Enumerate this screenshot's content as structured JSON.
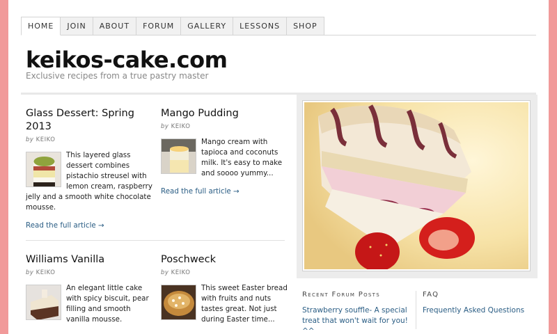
{
  "nav": {
    "items": [
      {
        "label": "HOME"
      },
      {
        "label": "JOIN"
      },
      {
        "label": "ABOUT"
      },
      {
        "label": "FORUM"
      },
      {
        "label": "GALLERY"
      },
      {
        "label": "LESSONS"
      },
      {
        "label": "SHOP"
      }
    ],
    "active_index": 0
  },
  "header": {
    "title": "keikos-cake.com",
    "tagline": "Exclusive recipes from a true pastry master"
  },
  "articles": [
    {
      "title": "Glass Dessert: Spring 2013",
      "by": "by",
      "author": "KEIKO",
      "excerpt": "This layered glass dessert combines pistachio streusel with lemon cream, raspberry jelly and a smooth white chocolate mousse.",
      "read_more": "Read the full article →"
    },
    {
      "title": "Mango Pudding",
      "by": "by",
      "author": "KEIKO",
      "excerpt": "Mango cream with tapioca and coconuts milk. It's easy to make and soooo yummy...",
      "read_more": "Read the full article →"
    },
    {
      "title": "Williams Vanilla",
      "by": "by",
      "author": "KEIKO",
      "excerpt": "An elegant little cake with spicy biscuit, pear filling and smooth vanilla mousse."
    },
    {
      "title": "Poschweck",
      "by": "by",
      "author": "KEIKO",
      "excerpt": "This sweet Easter bread with fruits and nuts tastes great. Not just during Easter time..."
    }
  ],
  "sidebar": {
    "recent_posts": {
      "title": "Recent Forum Posts",
      "link": "Strawberry souffle- A special treat that won't wait for you! ^^"
    },
    "faq": {
      "title": "FAQ",
      "link": "Frequently Asked Questions"
    }
  },
  "colors": {
    "background": "#f19a9a",
    "link": "#2a5d84"
  }
}
